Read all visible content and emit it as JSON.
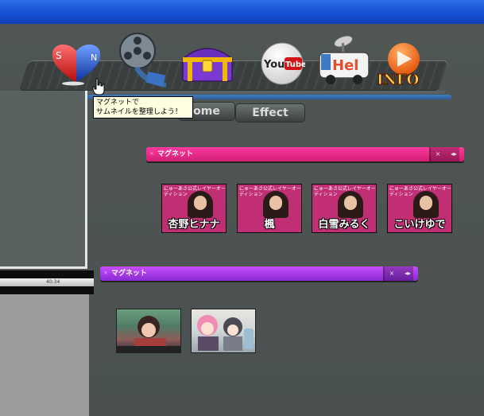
{
  "window": {
    "title": ""
  },
  "dock": {
    "items": [
      {
        "name": "magnet",
        "letters": [
          "S",
          "N"
        ]
      },
      {
        "name": "film"
      },
      {
        "name": "treasure-chest"
      },
      {
        "name": "youtube",
        "label": "YouTube"
      },
      {
        "name": "hello-truck",
        "label": "Hello"
      },
      {
        "name": "info",
        "label": "INFO"
      }
    ],
    "tooltip": {
      "line1": "マグネットで",
      "line2": "サムネイルを整理しよう！"
    }
  },
  "tabs": [
    {
      "label": "ome"
    },
    {
      "label": "Effect"
    }
  ],
  "timeline": {
    "tick_label": "40:34"
  },
  "groups": [
    {
      "label": "マグネット",
      "color": "#e0277f",
      "thumbnails": [
        {
          "caption": "にゅーあさ公式レイヤーオーディション",
          "name": "杏野ヒナナ"
        },
        {
          "caption": "にゅーあさ公式レイヤーオーディション",
          "name": "楓"
        },
        {
          "caption": "にゅーあさ公式レイヤーオーディション",
          "name": "白雪みるく"
        },
        {
          "caption": "にゅーあさ公式レイヤーオーディション",
          "name": "こいけゆで"
        }
      ]
    },
    {
      "label": "マグネット",
      "color": "#b23ae6",
      "thumbnails": [
        {
          "name": ""
        },
        {
          "name": ""
        }
      ]
    }
  ],
  "colors": {
    "titlebar": "#1450d6",
    "background": "#4d5453",
    "accent_blue": "#3e7ec7",
    "pink": "#e0277f",
    "purple": "#b23ae6"
  }
}
